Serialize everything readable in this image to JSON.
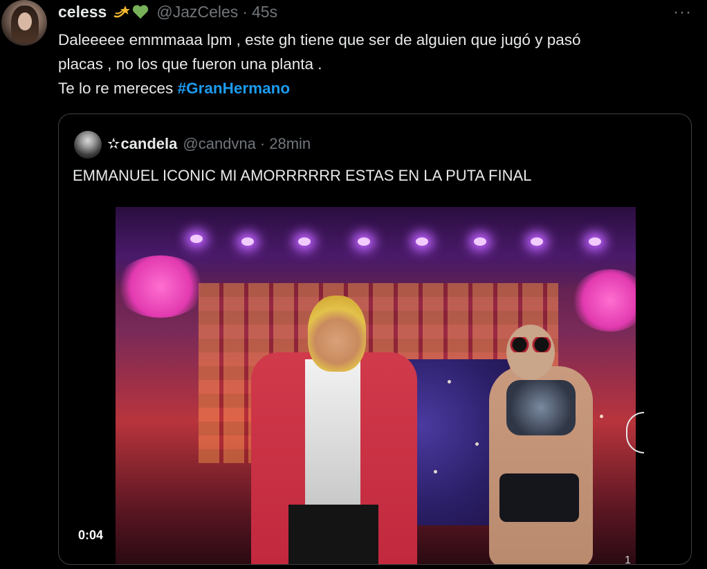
{
  "tweet": {
    "display_name": "celess",
    "emoji_icons": [
      "shooting-star-icon",
      "green-heart-icon"
    ],
    "handle": "@JazCeles",
    "separator": "·",
    "time": "45s",
    "more_label": "···",
    "text_line1": "Daleeeee emmmaaa lpm , este gh tiene que ser de alguien que jugó y pasó",
    "text_line2": "placas , no los que fueron una planta .",
    "text_line3_prefix": "Te lo re mereces ",
    "hashtag": "#GranHermano"
  },
  "quote": {
    "star": "✫",
    "display_name": "candela",
    "handle": "@candvna",
    "separator": "·",
    "time": "28min",
    "text": "EMMANUEL ICONIC MI AMORRRRRR ESTAS EN LA PUTA FINAL",
    "video": {
      "duration": "0:04",
      "media_count": "1"
    }
  },
  "colors": {
    "background": "#000000",
    "text": "#e7e9ea",
    "secondary": "#71767b",
    "link": "#1d9bf0",
    "border": "#3d4146"
  }
}
